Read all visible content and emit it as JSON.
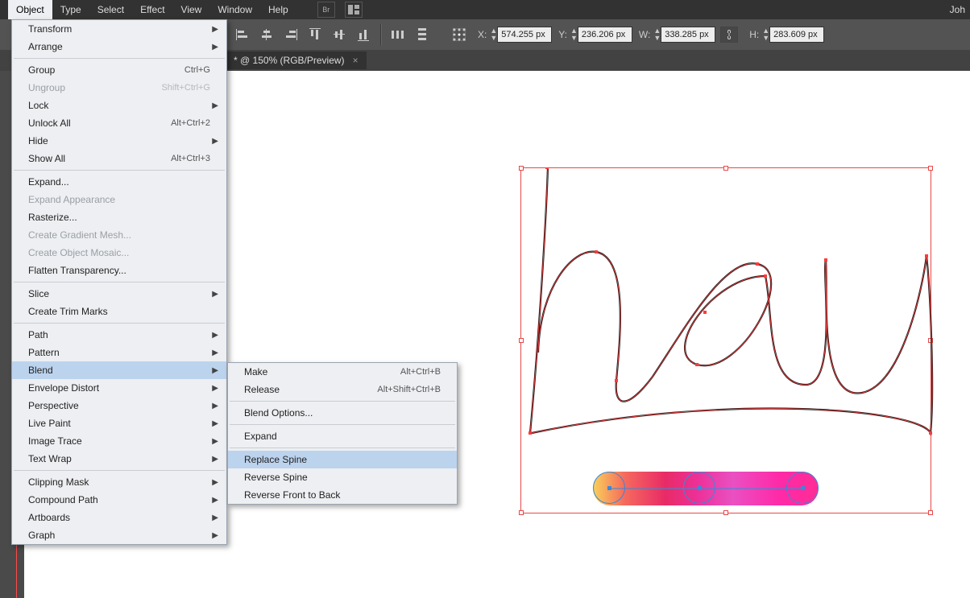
{
  "menubar": {
    "items": [
      "Object",
      "Type",
      "Select",
      "Effect",
      "View",
      "Window",
      "Help"
    ],
    "bridge_icon": "Br",
    "right_user": "Joh"
  },
  "controlbar": {
    "x_label": "X:",
    "x_value": "574.255 px",
    "y_label": "Y:",
    "y_value": "236.206 px",
    "w_label": "W:",
    "w_value": "338.285 px",
    "h_label": "H:",
    "h_value": "283.609 px"
  },
  "doctab": {
    "title": "* @ 150% (RGB/Preview)",
    "close": "×"
  },
  "object_menu": [
    {
      "label": "Transform",
      "arrow": true
    },
    {
      "label": "Arrange",
      "arrow": true
    },
    {
      "sep": true
    },
    {
      "label": "Group",
      "shortcut": "Ctrl+G"
    },
    {
      "label": "Ungroup",
      "shortcut": "Shift+Ctrl+G",
      "disabled": true
    },
    {
      "label": "Lock",
      "arrow": true
    },
    {
      "label": "Unlock All",
      "shortcut": "Alt+Ctrl+2"
    },
    {
      "label": "Hide",
      "arrow": true
    },
    {
      "label": "Show All",
      "shortcut": "Alt+Ctrl+3"
    },
    {
      "sep": true
    },
    {
      "label": "Expand..."
    },
    {
      "label": "Expand Appearance",
      "disabled": true
    },
    {
      "label": "Rasterize..."
    },
    {
      "label": "Create Gradient Mesh...",
      "disabled": true
    },
    {
      "label": "Create Object Mosaic...",
      "disabled": true
    },
    {
      "label": "Flatten Transparency..."
    },
    {
      "sep": true
    },
    {
      "label": "Slice",
      "arrow": true
    },
    {
      "label": "Create Trim Marks"
    },
    {
      "sep": true
    },
    {
      "label": "Path",
      "arrow": true
    },
    {
      "label": "Pattern",
      "arrow": true
    },
    {
      "label": "Blend",
      "arrow": true,
      "highlight": true
    },
    {
      "label": "Envelope Distort",
      "arrow": true
    },
    {
      "label": "Perspective",
      "arrow": true
    },
    {
      "label": "Live Paint",
      "arrow": true
    },
    {
      "label": "Image Trace",
      "arrow": true
    },
    {
      "label": "Text Wrap",
      "arrow": true
    },
    {
      "sep": true
    },
    {
      "label": "Clipping Mask",
      "arrow": true
    },
    {
      "label": "Compound Path",
      "arrow": true
    },
    {
      "label": "Artboards",
      "arrow": true
    },
    {
      "label": "Graph",
      "arrow": true
    }
  ],
  "blend_submenu": [
    {
      "label": "Make",
      "shortcut": "Alt+Ctrl+B"
    },
    {
      "label": "Release",
      "shortcut": "Alt+Shift+Ctrl+B"
    },
    {
      "sep": true
    },
    {
      "label": "Blend Options..."
    },
    {
      "sep": true
    },
    {
      "label": "Expand"
    },
    {
      "sep": true
    },
    {
      "label": "Replace Spine",
      "highlight": true
    },
    {
      "label": "Reverse Spine"
    },
    {
      "label": "Reverse Front to Back"
    }
  ]
}
